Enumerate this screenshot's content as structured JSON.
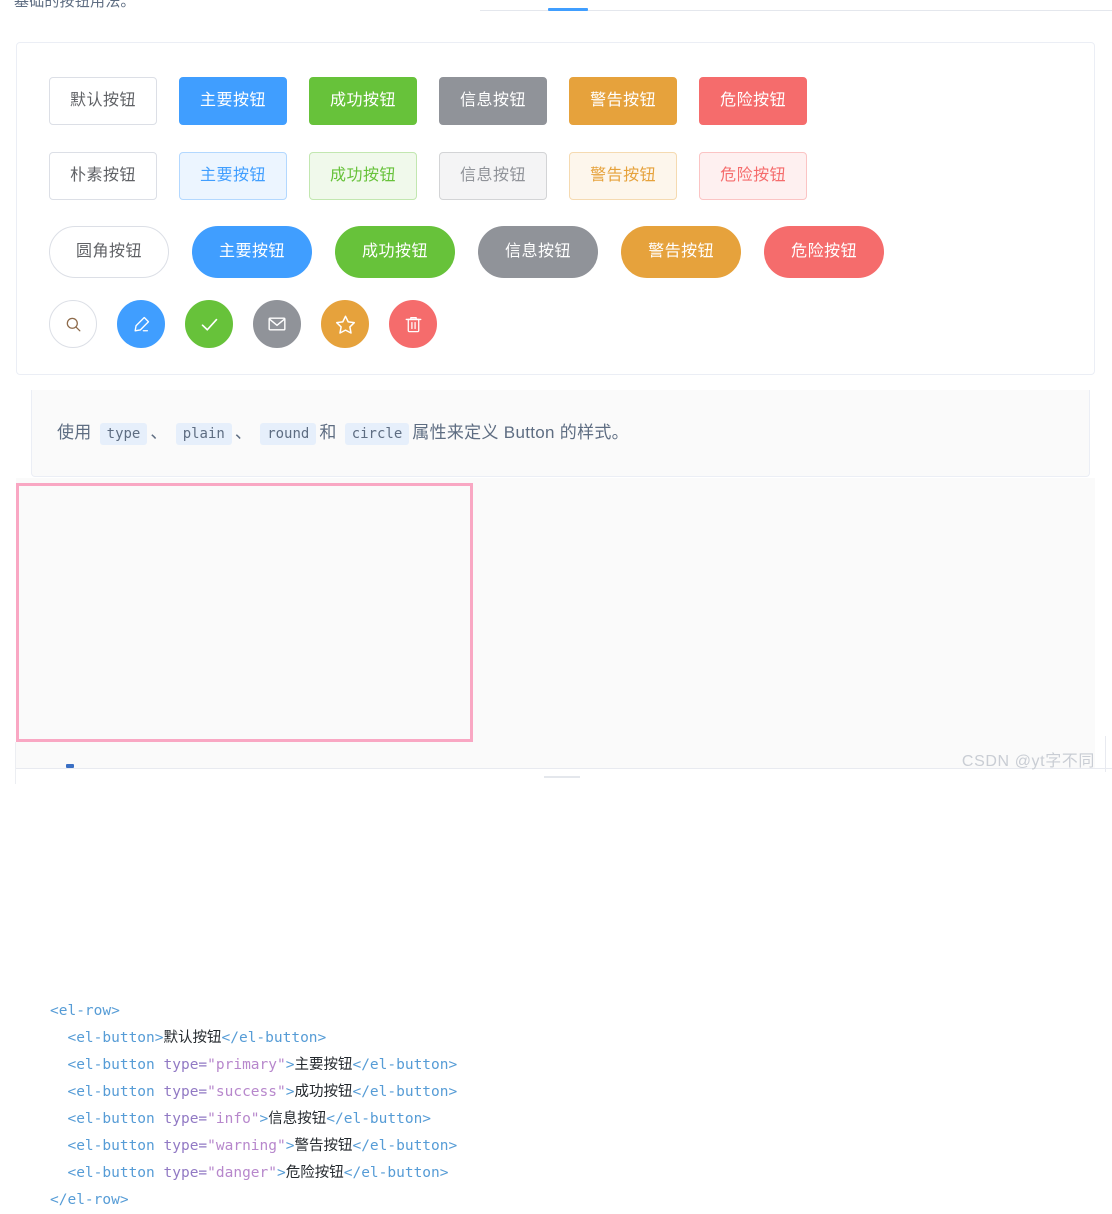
{
  "page": {
    "heading_fragment": "基础的按钮用法。",
    "watermark": "CSDN @yt字不同"
  },
  "demo": {
    "rows": [
      {
        "name": "basic",
        "buttons": [
          {
            "label": "默认按钮",
            "type": "default",
            "color": "#ffffff"
          },
          {
            "label": "主要按钮",
            "type": "primary",
            "color": "#409eff"
          },
          {
            "label": "成功按钮",
            "type": "success",
            "color": "#67c23a"
          },
          {
            "label": "信息按钮",
            "type": "info",
            "color": "#909399"
          },
          {
            "label": "警告按钮",
            "type": "warning",
            "color": "#e6a23c"
          },
          {
            "label": "危险按钮",
            "type": "danger",
            "color": "#f56c6c"
          }
        ]
      },
      {
        "name": "plain",
        "buttons": [
          {
            "label": "朴素按钮",
            "type": "default",
            "color": "#ffffff"
          },
          {
            "label": "主要按钮",
            "type": "primary",
            "color": "#ecf5ff"
          },
          {
            "label": "成功按钮",
            "type": "success",
            "color": "#f0f9eb"
          },
          {
            "label": "信息按钮",
            "type": "info",
            "color": "#f4f4f5"
          },
          {
            "label": "警告按钮",
            "type": "warning",
            "color": "#fdf6ec"
          },
          {
            "label": "危险按钮",
            "type": "danger",
            "color": "#fef0f0"
          }
        ]
      },
      {
        "name": "round",
        "buttons": [
          {
            "label": "圆角按钮",
            "type": "default",
            "color": "#ffffff"
          },
          {
            "label": "主要按钮",
            "type": "primary",
            "color": "#409eff"
          },
          {
            "label": "成功按钮",
            "type": "success",
            "color": "#67c23a"
          },
          {
            "label": "信息按钮",
            "type": "info",
            "color": "#909399"
          },
          {
            "label": "警告按钮",
            "type": "warning",
            "color": "#e6a23c"
          },
          {
            "label": "危险按钮",
            "type": "danger",
            "color": "#f56c6c"
          }
        ]
      },
      {
        "name": "circle",
        "buttons": [
          {
            "icon": "search-icon",
            "type": "default",
            "color": "#ffffff"
          },
          {
            "icon": "edit-icon",
            "type": "primary",
            "color": "#409eff"
          },
          {
            "icon": "check-icon",
            "type": "success",
            "color": "#67c23a"
          },
          {
            "icon": "message-icon",
            "type": "info",
            "color": "#909399"
          },
          {
            "icon": "star-icon",
            "type": "warning",
            "color": "#e6a23c"
          },
          {
            "icon": "delete-icon",
            "type": "danger",
            "color": "#f56c6c"
          }
        ]
      }
    ]
  },
  "description": {
    "lead": "使用",
    "code_type": "type",
    "sep1": "、",
    "code_plain": "plain",
    "sep2": "、",
    "code_round": "round",
    "conj": "和",
    "code_circle": "circle",
    "tail": "属性来定义 Button 的样式。"
  },
  "code": {
    "language": "vue-html",
    "lines": [
      {
        "indent": 0,
        "parts": [
          {
            "t": "tag",
            "s": "<el-row>"
          }
        ]
      },
      {
        "indent": 1,
        "parts": [
          {
            "t": "tag",
            "s": "<el-button>"
          },
          {
            "t": "text",
            "s": "默认按钮"
          },
          {
            "t": "tag",
            "s": "</el-button>"
          }
        ]
      },
      {
        "indent": 1,
        "parts": [
          {
            "t": "tag",
            "s": "<el-button "
          },
          {
            "t": "attr",
            "s": "type="
          },
          {
            "t": "val",
            "s": "\"primary\""
          },
          {
            "t": "tag",
            "s": ">"
          },
          {
            "t": "text",
            "s": "主要按钮"
          },
          {
            "t": "tag",
            "s": "</el-button>"
          }
        ]
      },
      {
        "indent": 1,
        "parts": [
          {
            "t": "tag",
            "s": "<el-button "
          },
          {
            "t": "attr",
            "s": "type="
          },
          {
            "t": "val",
            "s": "\"success\""
          },
          {
            "t": "tag",
            "s": ">"
          },
          {
            "t": "text",
            "s": "成功按钮"
          },
          {
            "t": "tag",
            "s": "</el-button>"
          }
        ]
      },
      {
        "indent": 1,
        "parts": [
          {
            "t": "tag",
            "s": "<el-button "
          },
          {
            "t": "attr",
            "s": "type="
          },
          {
            "t": "val",
            "s": "\"info\""
          },
          {
            "t": "tag",
            "s": ">"
          },
          {
            "t": "text",
            "s": "信息按钮"
          },
          {
            "t": "tag",
            "s": "</el-button>"
          }
        ]
      },
      {
        "indent": 1,
        "parts": [
          {
            "t": "tag",
            "s": "<el-button "
          },
          {
            "t": "attr",
            "s": "type="
          },
          {
            "t": "val",
            "s": "\"warning\""
          },
          {
            "t": "tag",
            "s": ">"
          },
          {
            "t": "text",
            "s": "警告按钮"
          },
          {
            "t": "tag",
            "s": "</el-button>"
          }
        ]
      },
      {
        "indent": 1,
        "parts": [
          {
            "t": "tag",
            "s": "<el-button "
          },
          {
            "t": "attr",
            "s": "type="
          },
          {
            "t": "val",
            "s": "\"danger\""
          },
          {
            "t": "tag",
            "s": ">"
          },
          {
            "t": "text",
            "s": "危险按钮"
          },
          {
            "t": "tag",
            "s": "</el-button>"
          }
        ]
      },
      {
        "indent": 0,
        "parts": [
          {
            "t": "tag",
            "s": "</el-row>"
          }
        ]
      }
    ],
    "highlight_color": "#f9a7c3"
  }
}
